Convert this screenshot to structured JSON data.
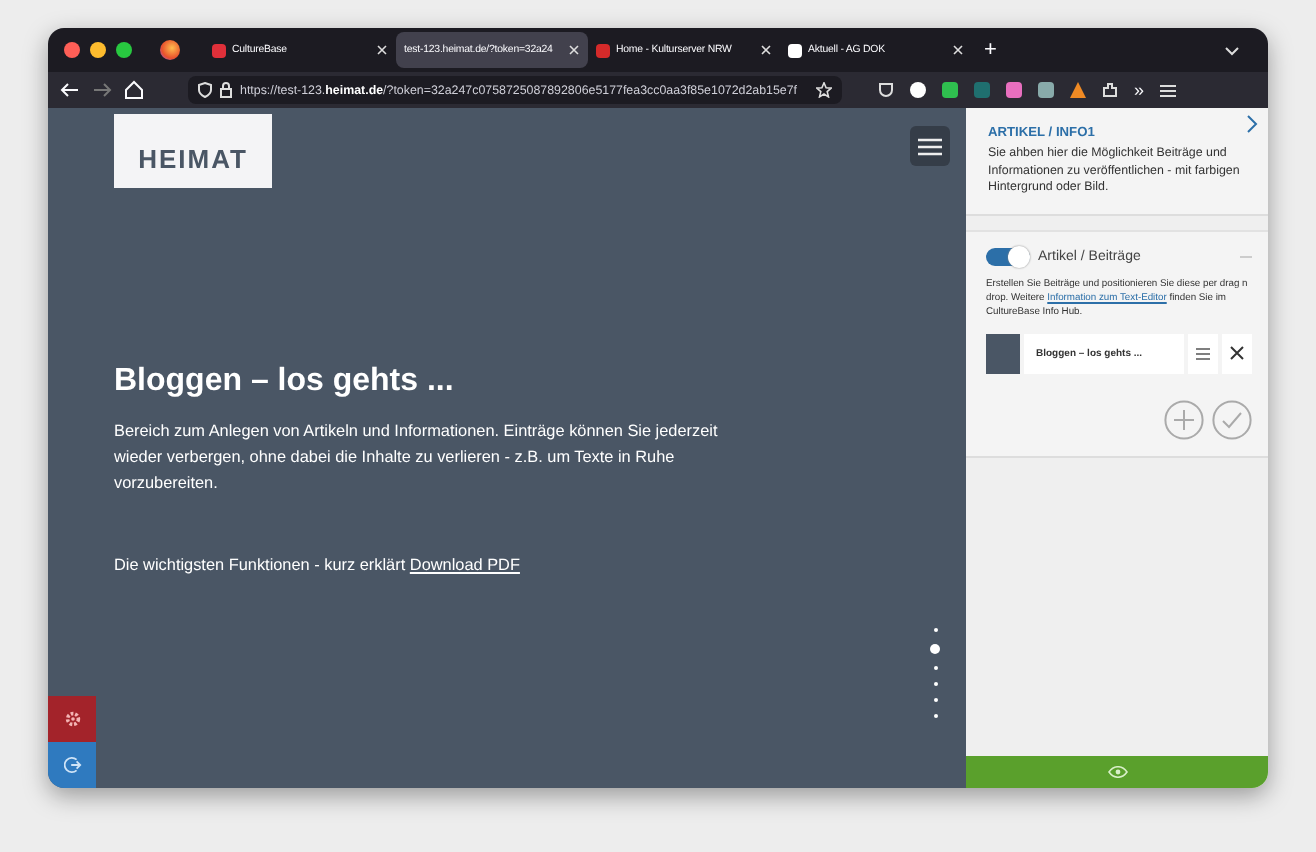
{
  "browser": {
    "tabs": [
      {
        "title": "CultureBase",
        "selected": false,
        "color": "#e0303a"
      },
      {
        "title": "test-123.heimat.de/?token=32a24",
        "selected": true
      },
      {
        "title": "Home - Kulturserver NRW",
        "selected": false,
        "color": "#d42a2a"
      },
      {
        "title": "Aktuell - AG DOK",
        "selected": false,
        "color": "#ffffff"
      }
    ],
    "new_tab": "+",
    "url": "https://test-123.**heimat.de**/?token=32a247c0758725087892806e5177fea3cc0aa3f85e1072d2ab15e7f",
    "overflow": "»"
  },
  "page": {
    "logo": "HEIMAT",
    "title": "Bloggen – los gehts ...",
    "body": "Bereich zum Anlegen von Artikeln und Informationen. Einträge können Sie jederzeit wieder verbergen, ohne dabei die Inhalte zu verlieren - z.B. um Texte in Ruhe vorzubereiten.",
    "functions_text": "Die wichtigsten Funktionen - kurz erklärt",
    "functions_link": "Download PDF",
    "dots": [
      {
        "selected": false
      },
      {
        "selected": true
      },
      {
        "selected": false
      },
      {
        "selected": false
      },
      {
        "selected": false
      },
      {
        "selected": false
      }
    ]
  },
  "sidebar": {
    "title": "ARTIKEL / INFO1",
    "description": "Sie ahben hier die Möglichkeit Beiträge und Informationen zu veröffentlichen - mit farbigen Hintergrund oder Bild.",
    "module": {
      "on": true,
      "label": "Artikel / Beiträge",
      "help_before": "Erstellen Sie Beiträge und positionieren Sie diese per drag n drop. Weitere",
      "help_link": "Information zum Text-Editor",
      "help_after": "finden Sie im CultureBase Info Hub.",
      "entries": [
        {
          "title": "Bloggen – los gehts ..."
        }
      ]
    }
  }
}
